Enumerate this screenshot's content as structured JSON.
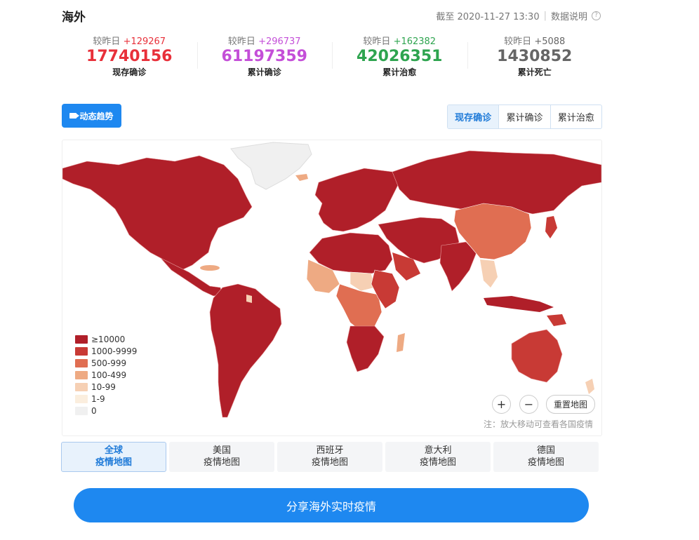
{
  "header": {
    "title": "海外",
    "updated": "截至 2020-11-27 13:30",
    "explain_label": "数据说明"
  },
  "colors": {
    "confirmed_now": "#e8303a",
    "total": "#c44fd8",
    "cured": "#2ea44f",
    "dead": "#666666",
    "primary": "#1e88f0"
  },
  "stats": [
    {
      "delta_label": "较昨日",
      "delta": "+129267",
      "value": "17740156",
      "label": "现存确诊"
    },
    {
      "delta_label": "较昨日",
      "delta": "+296737",
      "value": "61197359",
      "label": "累计确诊"
    },
    {
      "delta_label": "较昨日",
      "delta": "+162382",
      "value": "42026351",
      "label": "累计治愈"
    },
    {
      "delta_label": "较昨日",
      "delta": "+5088",
      "value": "1430852",
      "label": "累计死亡"
    }
  ],
  "toolbar": {
    "trend_label": "动态趋势",
    "segments": [
      "现存确诊",
      "累计确诊",
      "累计治愈"
    ],
    "active_segment": "现存确诊"
  },
  "map": {
    "legend": [
      {
        "label": "≥10000",
        "color": "#b01f29"
      },
      {
        "label": "1000-9999",
        "color": "#c83a35"
      },
      {
        "label": "500-999",
        "color": "#e06e52"
      },
      {
        "label": "100-499",
        "color": "#eeaa83"
      },
      {
        "label": "10-99",
        "color": "#f6d0b4"
      },
      {
        "label": "1-9",
        "color": "#fbeede"
      },
      {
        "label": "0",
        "color": "#f0f0f0"
      }
    ],
    "zoom_in": "+",
    "zoom_out": "−",
    "reset_label": "重置地图",
    "note": "注：放大移动可查看各国疫情"
  },
  "tabs": [
    {
      "line1": "全球",
      "line2": "疫情地图",
      "active": true
    },
    {
      "line1": "美国",
      "line2": "疫情地图",
      "active": false
    },
    {
      "line1": "西班牙",
      "line2": "疫情地图",
      "active": false
    },
    {
      "line1": "意大利",
      "line2": "疫情地图",
      "active": false
    },
    {
      "line1": "德国",
      "line2": "疫情地图",
      "active": false
    }
  ],
  "share_label": "分享海外实时疫情"
}
